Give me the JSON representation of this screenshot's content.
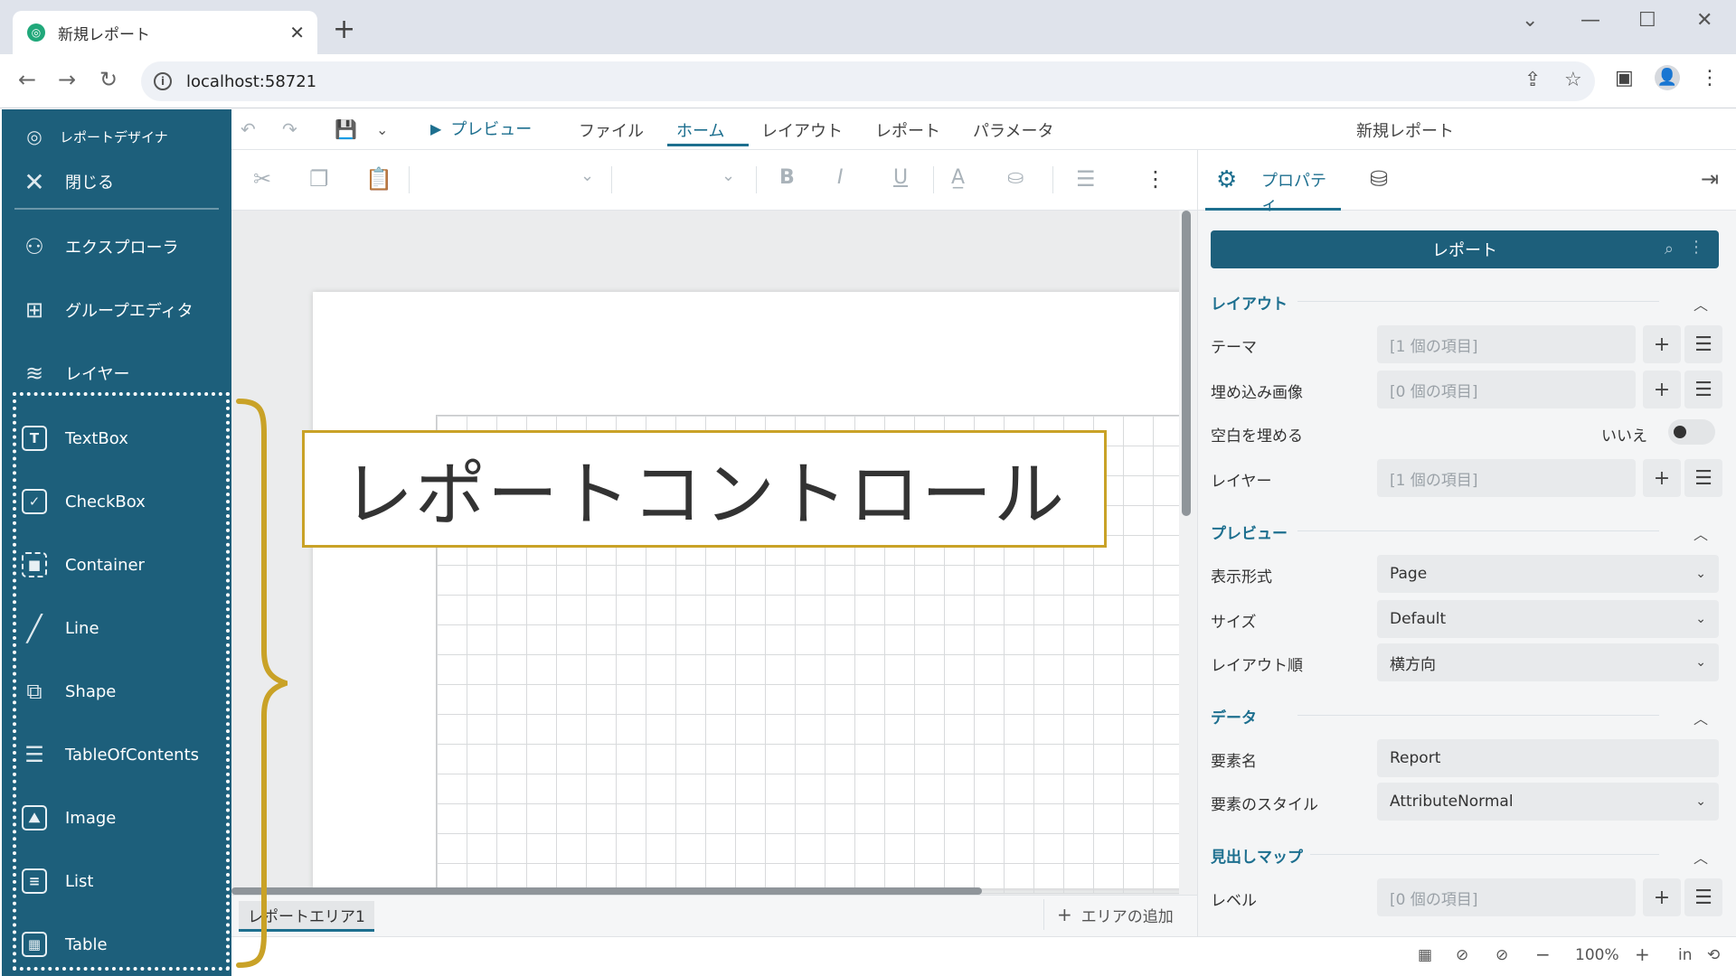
{
  "browser": {
    "tab_title": "新規レポート",
    "url": "localhost:58721"
  },
  "sidebar": {
    "app_title": "レポートデザイナ",
    "close_label": "閉じる",
    "nav": [
      {
        "label": "エクスプローラ",
        "icon": "explorer-icon"
      },
      {
        "label": "グループエディタ",
        "icon": "group-editor-icon"
      },
      {
        "label": "レイヤー",
        "icon": "layers-icon"
      }
    ],
    "controls": [
      {
        "label": "TextBox",
        "icon": "textbox-icon"
      },
      {
        "label": "CheckBox",
        "icon": "checkbox-icon"
      },
      {
        "label": "Container",
        "icon": "container-icon"
      },
      {
        "label": "Line",
        "icon": "line-icon"
      },
      {
        "label": "Shape",
        "icon": "shape-icon"
      },
      {
        "label": "TableOfContents",
        "icon": "table-of-contents-icon"
      },
      {
        "label": "Image",
        "icon": "image-icon"
      },
      {
        "label": "List",
        "icon": "list-icon"
      },
      {
        "label": "Table",
        "icon": "table-icon"
      }
    ]
  },
  "menu": {
    "preview": "プレビュー",
    "items": [
      "ファイル",
      "ホーム",
      "レイアウト",
      "レポート",
      "パラメータ"
    ],
    "active": "ホーム",
    "doc_title": "新規レポート"
  },
  "callout": {
    "text": "レポートコントロール",
    "color": "#c9a227"
  },
  "canvas": {
    "area_tab": "レポートエリア1",
    "add_area": "エリアの追加"
  },
  "status": {
    "zoom": "100%",
    "unit": "in",
    "zoom_out": "−",
    "zoom_in": "+"
  },
  "properties": {
    "tab_label": "プロパティ",
    "header": "レポート",
    "sections": {
      "layout": "レイアウト",
      "preview": "プレビュー",
      "data": "データ",
      "bookmarks": "見出しマップ"
    },
    "rows": {
      "theme": {
        "label": "テーマ",
        "value": "[1 個の項目]"
      },
      "embedded_images": {
        "label": "埋め込み画像",
        "value": "[0 個の項目]"
      },
      "fill_blank": {
        "label": "空白を埋める",
        "value": "いいえ"
      },
      "layers": {
        "label": "レイヤー",
        "value": "[1 個の項目]"
      },
      "display_format": {
        "label": "表示形式",
        "value": "Page"
      },
      "size": {
        "label": "サイズ",
        "value": "Default"
      },
      "layout_order": {
        "label": "レイアウト順",
        "value": "横方向"
      },
      "element_name": {
        "label": "要素名",
        "value": "Report"
      },
      "element_style": {
        "label": "要素のスタイル",
        "value": "AttributeNormal"
      },
      "level": {
        "label": "レベル",
        "value": "[0 個の項目]"
      }
    }
  },
  "colors": {
    "sidebar_bg": "#1d5f7b",
    "accent": "#1d6f8f"
  }
}
